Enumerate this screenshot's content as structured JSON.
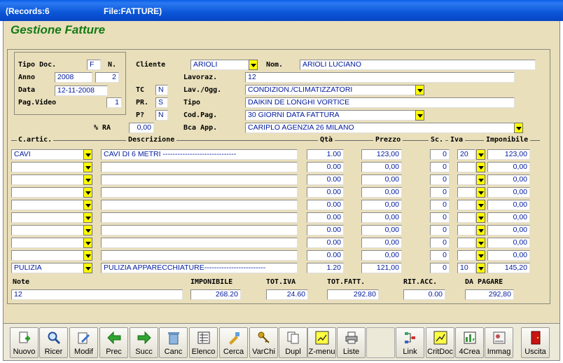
{
  "titlebar": {
    "records": "(Records:6",
    "file": "File:FATTURE)"
  },
  "heading": "Gestione Fatture",
  "doc": {
    "tipo_label": "Tipo Doc.",
    "tipo": "F",
    "n_label": "N.",
    "anno_label": "Anno",
    "anno": "2008",
    "numero": "2",
    "data_label": "Data",
    "data": "12-11-2008",
    "pag_label": "Pag.Video",
    "pag": "1"
  },
  "header": {
    "cliente_label": "Cliente",
    "cliente": "ARIOLI",
    "nom_label": "Nom.",
    "nom": "ARIOLI LUCIANO",
    "lavoraz_label": "Lavoraz.",
    "lavoraz": "12",
    "tc_label": "TC",
    "tc": "N",
    "lavogg_label": "Lav./Ogg.",
    "lavogg": "CONDIZION./CLIMATIZZATORI",
    "pr_label": "PR.",
    "pr": "S",
    "tipo_label": "Tipo",
    "tipo": "DAIKIN   DE LONGHI   VORTICE",
    "p_label": "P?",
    "p": "N",
    "codpag_label": "Cod.Pag.",
    "codpag": "30 GIORNI DATA FATTURA",
    "ra_label": "% RA",
    "ra": "0,00",
    "bca_label": "Bca App.",
    "bca": "CARIPLO     AGENZIA 26    MILANO"
  },
  "columns": {
    "cartic": "C.artic.",
    "descr": "Descrizione",
    "qta": "Qtà",
    "prezzo": "Prezzo",
    "sc": "Sc.",
    "iva": "Iva",
    "imponibile": "Imponibile"
  },
  "rows": [
    {
      "cod": "CAVI",
      "descr": "CAVI DI 6 METRI ------------------------------",
      "qta": "1.00",
      "prezzo": "123,00",
      "sc": "0",
      "iva": "20",
      "imp": "123,00"
    },
    {
      "cod": "",
      "descr": "",
      "qta": "0.00",
      "prezzo": "0,00",
      "sc": "0",
      "iva": "",
      "imp": "0,00"
    },
    {
      "cod": "",
      "descr": "",
      "qta": "0.00",
      "prezzo": "0,00",
      "sc": "0",
      "iva": "",
      "imp": "0,00"
    },
    {
      "cod": "",
      "descr": "",
      "qta": "0.00",
      "prezzo": "0,00",
      "sc": "0",
      "iva": "",
      "imp": "0,00"
    },
    {
      "cod": "",
      "descr": "",
      "qta": "0.00",
      "prezzo": "0,00",
      "sc": "0",
      "iva": "",
      "imp": "0,00"
    },
    {
      "cod": "",
      "descr": "",
      "qta": "0.00",
      "prezzo": "0,00",
      "sc": "0",
      "iva": "",
      "imp": "0,00"
    },
    {
      "cod": "",
      "descr": "",
      "qta": "0.00",
      "prezzo": "0,00",
      "sc": "0",
      "iva": "",
      "imp": "0,00"
    },
    {
      "cod": "",
      "descr": "",
      "qta": "0.00",
      "prezzo": "0,00",
      "sc": "0",
      "iva": "",
      "imp": "0,00"
    },
    {
      "cod": "",
      "descr": "",
      "qta": "0.00",
      "prezzo": "0,00",
      "sc": "0",
      "iva": "",
      "imp": "0,00"
    },
    {
      "cod": "PULIZIA",
      "descr": "PULIZIA APPARECCHIATURE-------------------------",
      "qta": "1.20",
      "prezzo": "121,00",
      "sc": "0",
      "iva": "10",
      "imp": "145,20"
    }
  ],
  "totals": {
    "note_label": "Note",
    "note": "12",
    "imponibile_label": "IMPONIBILE",
    "imponibile": "268.20",
    "totiva_label": "TOT.IVA",
    "totiva": "24.60",
    "totfatt_label": "TOT.FATT.",
    "totfatt": "292.80",
    "ritacc_label": "RIT.ACC.",
    "ritacc": "0.00",
    "dapagare_label": "DA PAGARE",
    "dapagare": "292,80"
  },
  "toolbar": [
    {
      "label": "Nuovo",
      "icon": "new-doc-icon"
    },
    {
      "label": "Ricer",
      "icon": "search-icon"
    },
    {
      "label": "Modif",
      "icon": "edit-icon"
    },
    {
      "label": "Prec",
      "icon": "arrow-left-icon"
    },
    {
      "label": "Succ",
      "icon": "arrow-right-icon"
    },
    {
      "label": "Canc",
      "icon": "trash-icon"
    },
    {
      "label": "Elenco",
      "icon": "list-icon"
    },
    {
      "label": "Cerca",
      "icon": "find-icon"
    },
    {
      "label": "VarChi",
      "icon": "keys-icon"
    },
    {
      "label": "Dupl",
      "icon": "duplicate-icon"
    },
    {
      "label": "Z-menu",
      "icon": "menu-icon"
    },
    {
      "label": "Liste",
      "icon": "printer-icon"
    },
    {
      "label": "Link",
      "icon": "link-icon"
    },
    {
      "label": "CritDoc",
      "icon": "critdoc-icon"
    },
    {
      "label": "4Crea",
      "icon": "create-icon"
    },
    {
      "label": "Immag",
      "icon": "image-icon"
    },
    {
      "label": "Uscita",
      "icon": "exit-icon"
    }
  ]
}
